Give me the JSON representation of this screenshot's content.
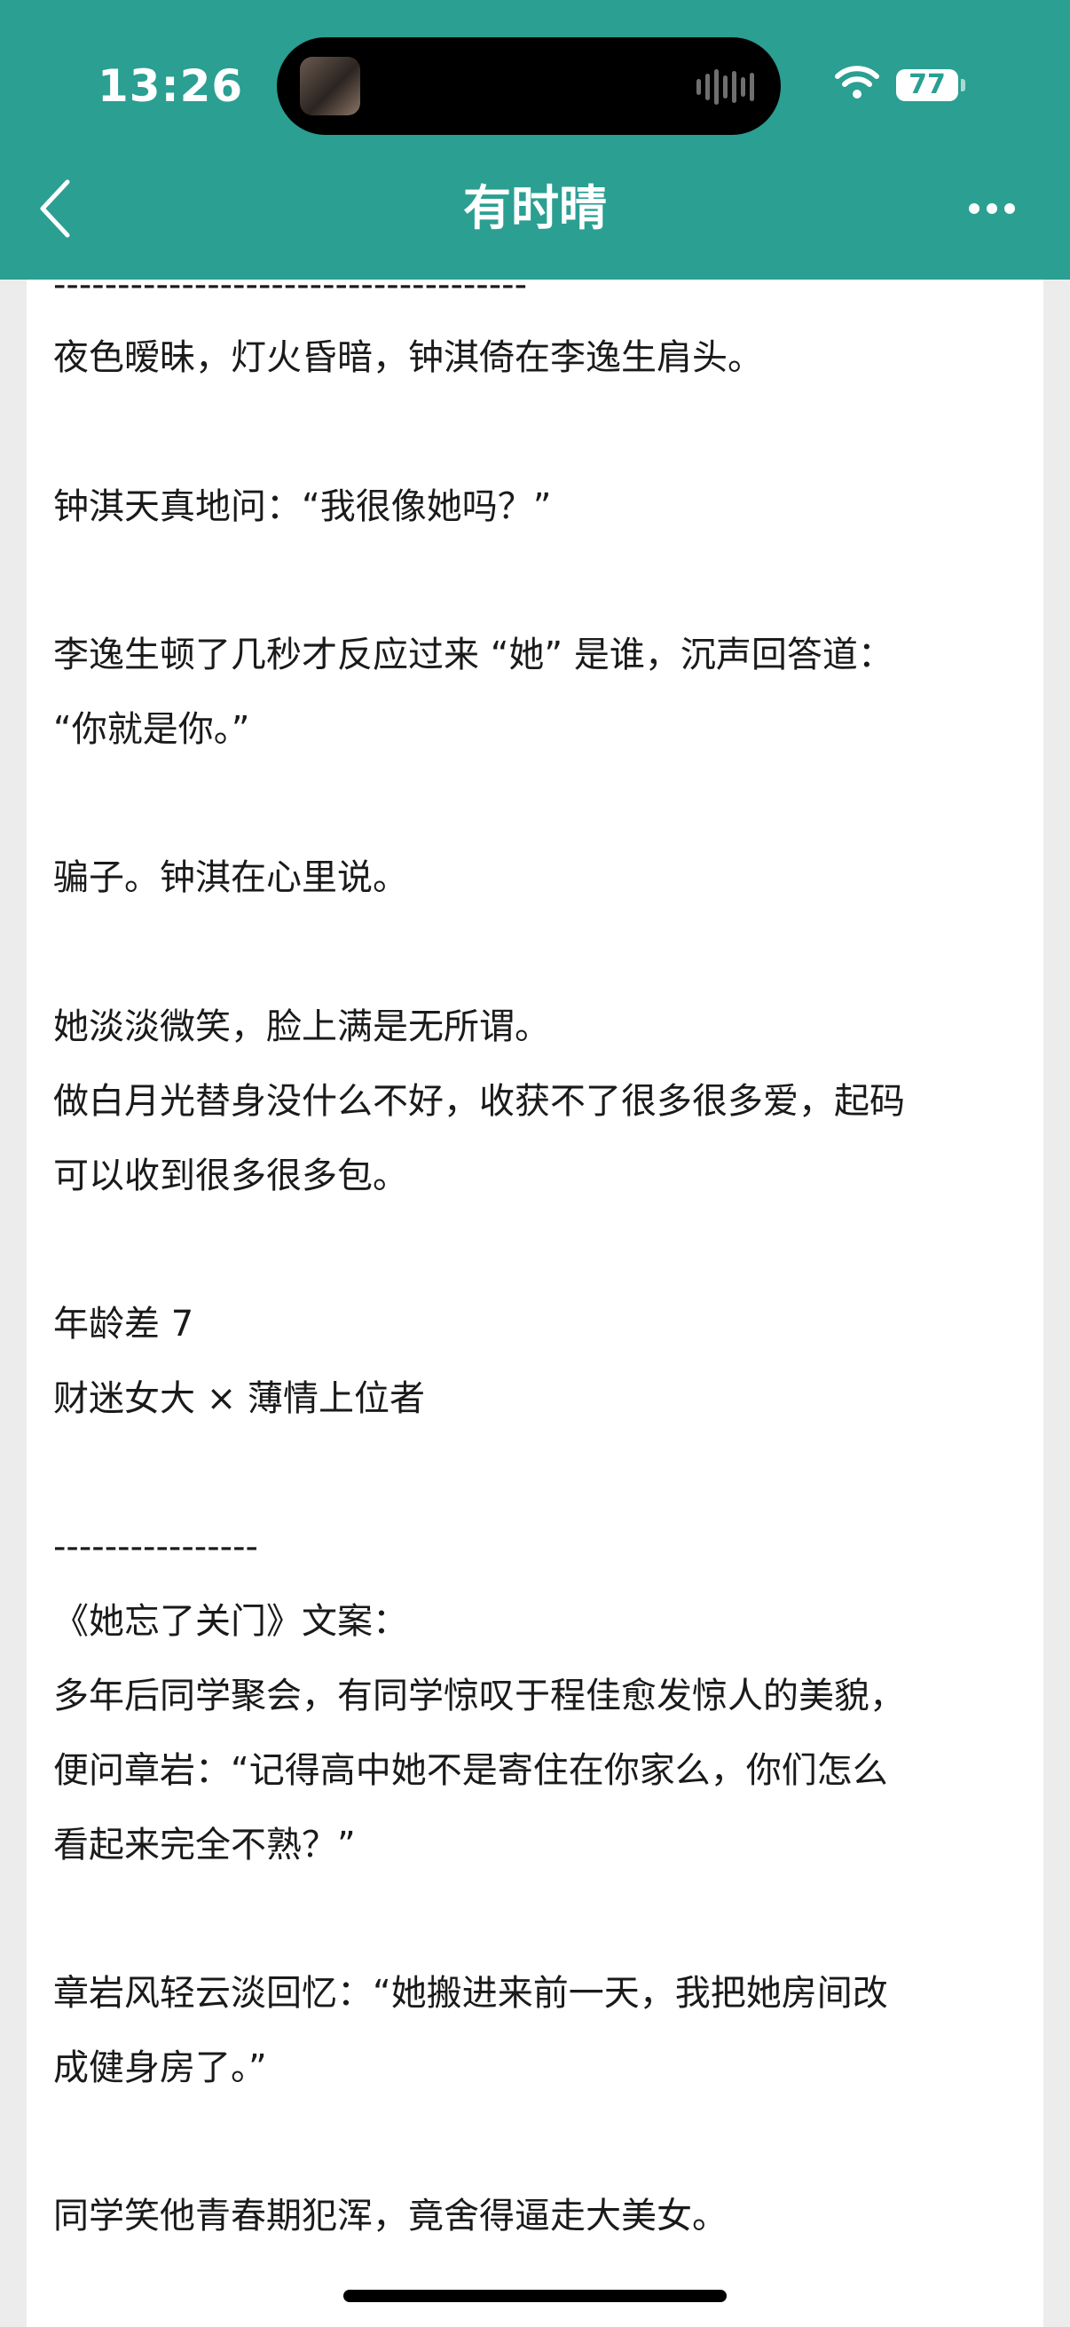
{
  "status_bar": {
    "time": "13:26",
    "battery": "77",
    "wifi_icon": "wifi-icon"
  },
  "nav": {
    "title": "有时晴",
    "back_icon": "chevron-left-icon",
    "more_icon": "more-horizontal-icon"
  },
  "content": {
    "lines": [
      "-------------------------------------",
      "夜色暧昧，灯火昏暗，钟淇倚在李逸生肩头。",
      "钟淇天真地问：“我很像她吗？”",
      "李逸生顿了几秒才反应过来 “她” 是谁，沉声回答道：",
      "“你就是你。”",
      "骗子。钟淇在心里说。",
      "她淡淡微笑，脸上满是无所谓。",
      "做白月光替身没什么不好，收获不了很多很多爱，起码",
      "可以收到很多很多包。",
      "年龄差 7",
      "财迷女大 × 薄情上位者",
      "----------------",
      "《她忘了关门》文案：",
      "多年后同学聚会，有同学惊叹于程佳愈发惊人的美貌，",
      "便问章岩：“记得高中她不是寄住在你家么，你们怎么",
      "看起来完全不熟？”",
      "章岩风轻云淡回忆：“她搬进来前一天，我把她房间改",
      "成健身房了。”",
      "同学笑他青春期犯浑，竟舍得逼走大美女。"
    ]
  },
  "colors": {
    "header": "#2a9f92",
    "text": "#1a1a1a",
    "page_background": "#ececec"
  }
}
